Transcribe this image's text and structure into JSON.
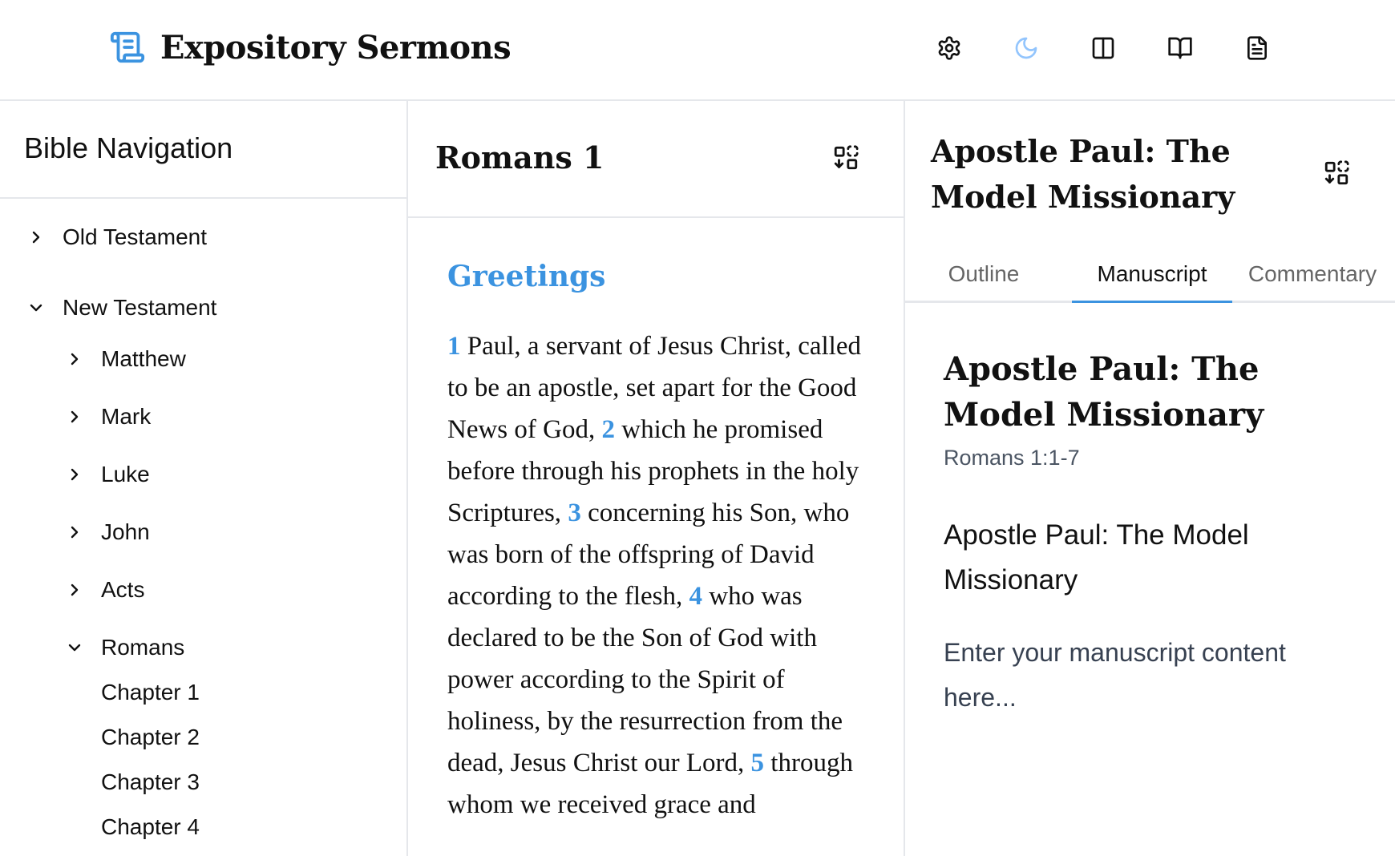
{
  "app": {
    "title": "Expository Sermons",
    "accent_color": "#3b93e0",
    "toolbar": [
      {
        "icon": "gear-icon",
        "label": "Settings"
      },
      {
        "icon": "moon-icon",
        "label": "Dark mode"
      },
      {
        "icon": "columns-icon",
        "label": "Split view"
      },
      {
        "icon": "book-open-icon",
        "label": "Bible"
      },
      {
        "icon": "document-icon",
        "label": "Manuscript"
      }
    ]
  },
  "nav": {
    "title": "Bible Navigation",
    "testaments": [
      {
        "label": "Old Testament",
        "expanded": false
      },
      {
        "label": "New Testament",
        "expanded": true
      }
    ],
    "books": [
      {
        "label": "Matthew",
        "expanded": false
      },
      {
        "label": "Mark",
        "expanded": false
      },
      {
        "label": "Luke",
        "expanded": false
      },
      {
        "label": "John",
        "expanded": false
      },
      {
        "label": "Acts",
        "expanded": false
      },
      {
        "label": "Romans",
        "expanded": true
      }
    ],
    "chapters": [
      "Chapter 1",
      "Chapter 2",
      "Chapter 3",
      "Chapter 4"
    ]
  },
  "scripture": {
    "title": "Romans 1",
    "heading": "Greetings",
    "verses": [
      {
        "num": "1",
        "text": "Paul, a servant of Jesus Christ, called to be an apostle, set apart for the Good News of God,"
      },
      {
        "num": "2",
        "text": "which he promised before through his prophets in the holy Scriptures,"
      },
      {
        "num": "3",
        "text": "concerning his Son, who was born of the offspring of David according to the flesh,"
      },
      {
        "num": "4",
        "text": "who was declared to be the Son of God with power according to the Spirit of holiness, by the resurrection from the dead, Jesus Christ our Lord,"
      },
      {
        "num": "5",
        "text": "through whom we received grace and"
      }
    ]
  },
  "sermon": {
    "title": "Apostle Paul: The Model Missionary",
    "tabs": [
      "Outline",
      "Manuscript",
      "Commentary"
    ],
    "active_tab": "Manuscript",
    "manuscript": {
      "title": "Apostle Paul: The Model Missionary",
      "reference": "Romans 1:1-7",
      "subtitle": "Apostle Paul: The Model Missionary",
      "placeholder": "Enter your manuscript content here..."
    }
  }
}
